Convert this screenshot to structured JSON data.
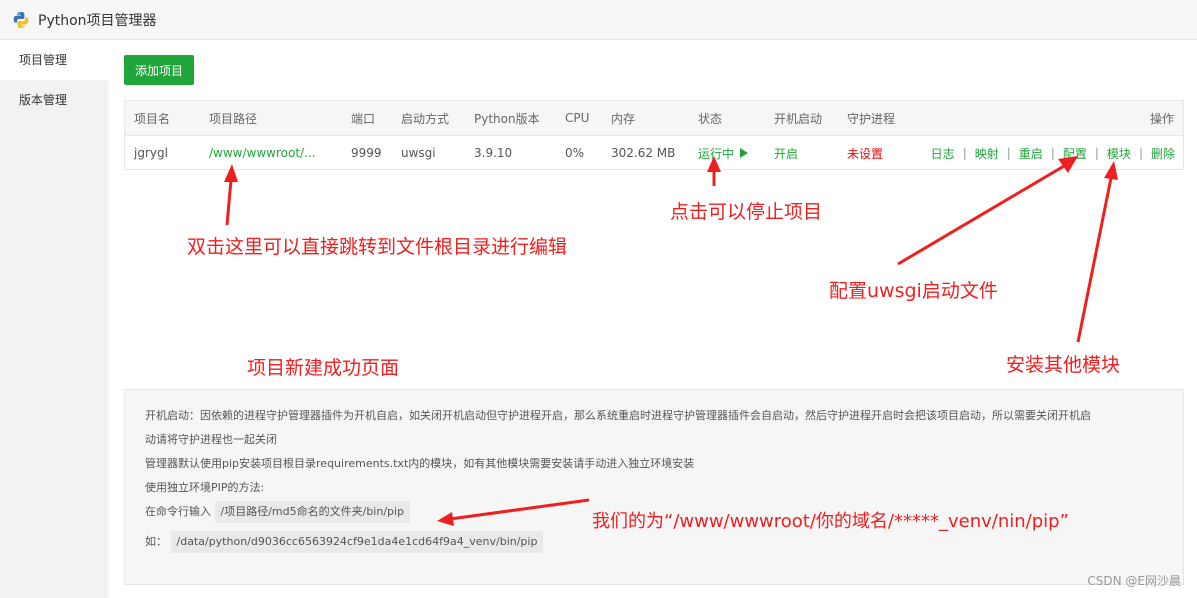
{
  "window": {
    "title": "Python项目管理器",
    "icon": "python-logo-icon"
  },
  "sidebar": {
    "items": [
      {
        "label": "项目管理"
      },
      {
        "label": "版本管理"
      }
    ]
  },
  "toolbar": {
    "add_label": "添加项目"
  },
  "table": {
    "headers": {
      "name": "项目名",
      "path": "项目路径",
      "port": "端口",
      "mode": "启动方式",
      "pyver": "Python版本",
      "cpu": "CPU",
      "mem": "内存",
      "status": "状态",
      "boot": "开机启动",
      "guard": "守护进程",
      "ops": "操作"
    },
    "row": {
      "name": "jgrygl",
      "path": "/www/wwwroot/...",
      "port": "9999",
      "mode": "uwsgi",
      "pyver": "3.9.10",
      "cpu": "0%",
      "mem": "302.62 MB",
      "status": "运行中",
      "boot": "开启",
      "guard": "未设置",
      "ops": [
        "日志",
        "映射",
        "重启",
        "配置",
        "模块",
        "删除"
      ]
    }
  },
  "notes": {
    "line1": "开机启动：因依赖的进程守护管理器插件为开机自启，如关闭开机启动但守护进程开启，那么系统重启时进程守护管理器插件会自启动，然后守护进程开启时会把该项目启动，所以需要关闭开机启",
    "line2": "动请将守护进程也一起关闭",
    "line3": "管理器默认使用pip安装项目根目录requirements.txt内的模块，如有其他模块需要安装请手动进入独立环境安装",
    "line4": "使用独立环境PIP的方法:",
    "line5_prefix": "在命令行输入",
    "line5_code": "/项目路径/md5命名的文件夹/bin/pip",
    "line6_prefix": "如：",
    "line6_code": "/data/python/d9036cc6563924cf9e1da4e1cd64f9a4_venv/bin/pip"
  },
  "annotations": {
    "path_note": "双击这里可以直接跳转到文件根目录进行编辑",
    "status_note": "点击可以停止项目",
    "config_note": "配置uwsgi启动文件",
    "module_note": "安装其他模块",
    "page_note": "项目新建成功页面",
    "pip_note": "我们的为“/www/wwwroot/你的域名/*****_venv/nin/pip”"
  },
  "watermark": "CSDN @E网沙晨",
  "colors": {
    "accent": "#20a53a",
    "danger": "#ef0808",
    "annotation": "#ef1f1f"
  }
}
